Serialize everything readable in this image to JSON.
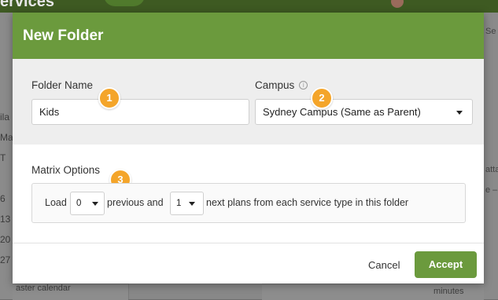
{
  "background": {
    "app_title_fragment": "ervices",
    "left_column_cells": [
      "ila",
      "Ma",
      "T",
      "6",
      "13",
      "20",
      "27"
    ],
    "right_strip_texts": [
      "Se",
      "atta",
      "e –",
      "min"
    ],
    "bottom_text": "aster calendar",
    "bottom_right_text": "minutes"
  },
  "modal": {
    "title": "New Folder",
    "folder_name": {
      "label": "Folder Name",
      "value": "Kids",
      "badge": "1"
    },
    "campus": {
      "label": "Campus",
      "info_icon": "info-icon",
      "selected": "Sydney Campus (Same as Parent)",
      "badge": "2"
    },
    "matrix": {
      "label": "Matrix Options",
      "badge": "3",
      "load_text": "Load",
      "previous_value": "0",
      "previous_text": "previous and",
      "next_value": "1",
      "next_text": "next plans from each service type in this folder"
    },
    "footer": {
      "cancel_label": "Cancel",
      "accept_label": "Accept"
    }
  },
  "colors": {
    "header_green": "#6b9a3d",
    "badge_orange": "#f4a52a",
    "accept_green": "#6b9a3d"
  }
}
